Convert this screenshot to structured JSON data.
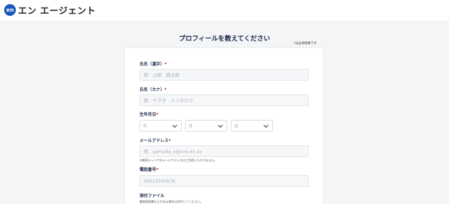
{
  "header": {
    "logo_badge": "en",
    "logo_text": "エン エージェント"
  },
  "page": {
    "title": "プロフィールを教えてください"
  },
  "required_note": {
    "asterisk": "*",
    "text": "は必須項目です"
  },
  "form": {
    "name_kanji": {
      "label": "氏名（漢字）",
      "required": "*",
      "placeholder": "例：山田　縁太郎"
    },
    "name_kana": {
      "label": "氏名（カナ）",
      "required": "*",
      "placeholder": "例：ヤマダ　エンタロウ"
    },
    "birthdate": {
      "label": "生年月日",
      "required": "*",
      "year": "年",
      "month": "月",
      "day": "日"
    },
    "email": {
      "label": "メールアドレス",
      "required": "*",
      "placeholder": "例：yamada_e@xxx.xx.xx",
      "hint": "※携帯キャリアのメールアドレスはご利用いただけません。"
    },
    "phone": {
      "label": "電話番号",
      "required": "*",
      "placeholder": "09012345678"
    },
    "attachment": {
      "label": "添付ファイル",
      "hint": "職務経歴書などがある場合は添付してください。"
    }
  },
  "colors": {
    "accent": "#1c58b8",
    "required": "#d0021b",
    "heading": "#1b2a4a"
  }
}
